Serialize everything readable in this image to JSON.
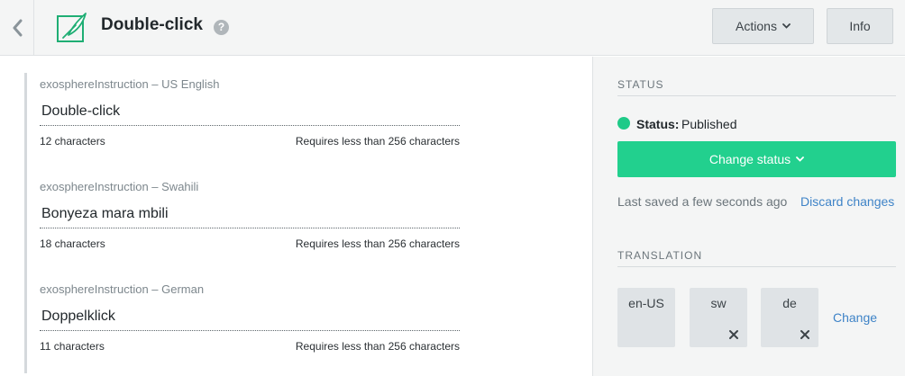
{
  "header": {
    "title": "Double-click",
    "help_glyph": "?",
    "actions_label": "Actions",
    "info_label": "Info"
  },
  "fields": [
    {
      "label": "exosphereInstruction – US English",
      "value": "Double-click",
      "count": "12 characters",
      "requirement": "Requires less than 256 characters"
    },
    {
      "label": "exosphereInstruction – Swahili",
      "value": "Bonyeza mara mbili",
      "count": "18 characters",
      "requirement": "Requires less than 256 characters"
    },
    {
      "label": "exosphereInstruction – German",
      "value": "Doppelklick",
      "count": "11 characters",
      "requirement": "Requires less than 256 characters"
    }
  ],
  "status": {
    "section_title": "STATUS",
    "label": "Status:",
    "value": "Published",
    "change_button": "Change status",
    "last_saved": "Last saved a few seconds ago",
    "discard": "Discard changes",
    "dot_color": "#1fca88"
  },
  "translation": {
    "section_title": "TRANSLATION",
    "languages": [
      {
        "code": "en-US"
      },
      {
        "code": "sw"
      },
      {
        "code": "de"
      }
    ],
    "change_label": "Change"
  },
  "colors": {
    "accent_green": "#22d08e",
    "link_blue": "#3e83c7"
  },
  "icons": {
    "back": "chevron-left-icon",
    "app": "feather-icon",
    "help": "question-mark-icon",
    "dropdown": "chevron-down-icon",
    "remove": "close-icon"
  }
}
